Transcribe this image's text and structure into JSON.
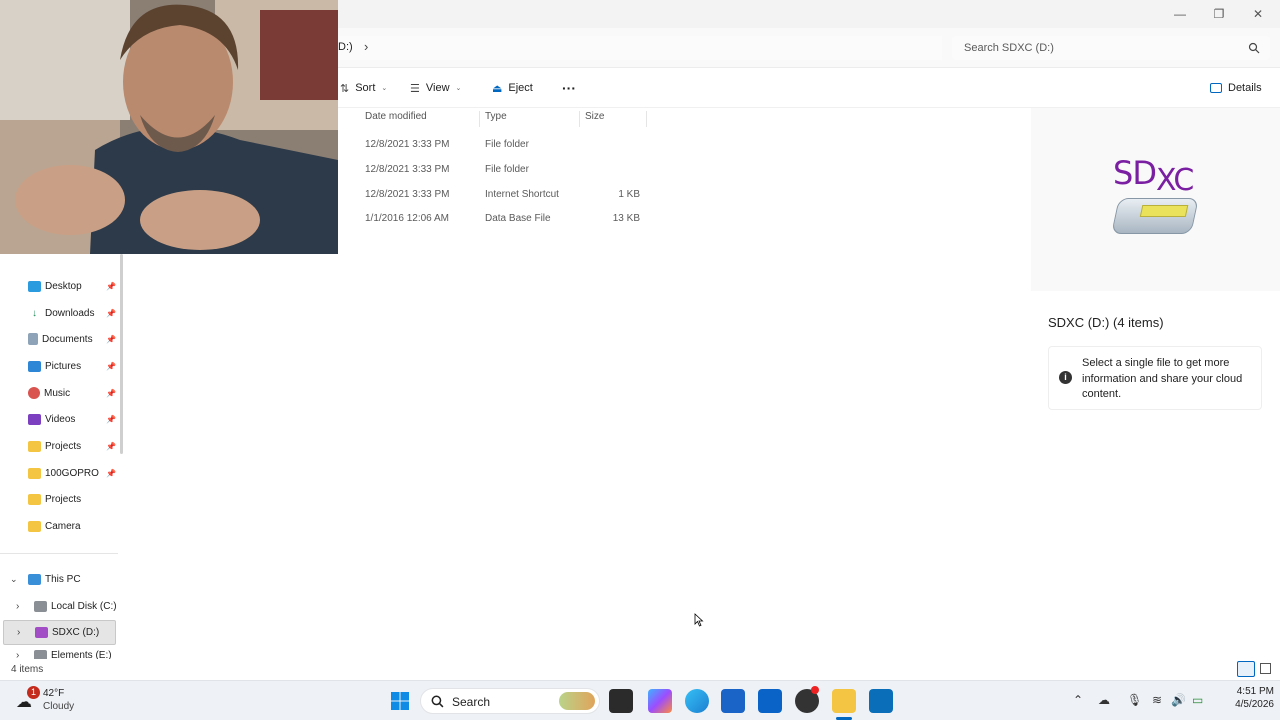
{
  "titlebar": {
    "minimize": "—",
    "maximize": "❐",
    "close": "✕"
  },
  "address": {
    "path_tail": "D:)",
    "chevron": "›",
    "search_placeholder": "Search SDXC (D:)"
  },
  "commands": {
    "sort": "Sort",
    "view": "View",
    "eject": "Eject",
    "more": "···",
    "details": "Details"
  },
  "columns": {
    "date": "Date modified",
    "type": "Type",
    "size": "Size"
  },
  "files": [
    {
      "date": "12/8/2021 3:33 PM",
      "type": "File folder",
      "size": ""
    },
    {
      "date": "12/8/2021 3:33 PM",
      "type": "File folder",
      "size": ""
    },
    {
      "date": "12/8/2021 3:33 PM",
      "type": "Internet Shortcut",
      "size": "1 KB"
    },
    {
      "date": "1/1/2016 12:06 AM",
      "type": "Data Base File",
      "size": "13 KB"
    }
  ],
  "sidebar": {
    "quick_access": [
      {
        "label": "Desktop",
        "icon": "desktop-icon",
        "pinned": true
      },
      {
        "label": "Downloads",
        "icon": "download-icon",
        "pinned": true
      },
      {
        "label": "Documents",
        "icon": "document-icon",
        "pinned": true
      },
      {
        "label": "Pictures",
        "icon": "pictures-icon",
        "pinned": true
      },
      {
        "label": "Music",
        "icon": "music-icon",
        "pinned": true
      },
      {
        "label": "Videos",
        "icon": "video-icon",
        "pinned": true
      },
      {
        "label": "Projects",
        "icon": "folder-icon",
        "pinned": true
      },
      {
        "label": "100GOPRO",
        "icon": "folder-icon",
        "pinned": true
      },
      {
        "label": "Projects",
        "icon": "folder-icon",
        "pinned": false
      },
      {
        "label": "Camera",
        "icon": "folder-icon",
        "pinned": false
      }
    ],
    "this_pc": "This PC",
    "drives": [
      {
        "label": "Local Disk (C:)",
        "selected": false
      },
      {
        "label": "SDXC (D:)",
        "selected": true
      },
      {
        "label": "Elements (E:)",
        "selected": false
      }
    ]
  },
  "details": {
    "logo_text_sd": "SD",
    "logo_text_xc": "XC",
    "title": "SDXC (D:) (4 items)",
    "info": "Select a single file to get more information and share your cloud content."
  },
  "status": {
    "count": "4 items"
  },
  "taskbar": {
    "weather_badge": "1",
    "temperature": "42°F",
    "condition": "Cloudy",
    "search": "Search",
    "time": "4:51 PM",
    "date": "4/5/2026"
  },
  "colors": {
    "accent": "#0067c0",
    "sdxc_purple": "#7a1fa2",
    "folder": "#f4c542",
    "selected_bg": "#e5e5e5"
  }
}
